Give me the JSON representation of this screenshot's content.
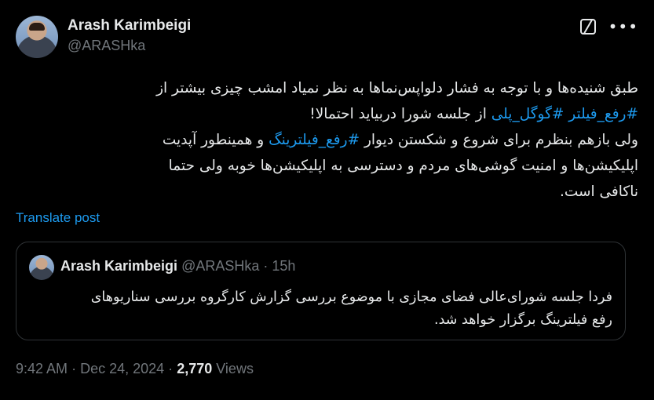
{
  "author": {
    "name": "Arash Karimbeigi",
    "handle": "@ARASHka"
  },
  "post": {
    "line1": "طبق شنیده‌ها و با توجه به فشار دلواپس‌نماها به نظر نمیاد امشب چیزی بیشتر از",
    "hashtag1": "#رفع_فیلتر",
    "hashtag2": "#گوگل_پلی",
    "line2_rest": "از جلسه شورا دربیاید احتمالا!",
    "line3_start": "ولی بازهم بنظرم برای شروع و شکستن دیوار",
    "hashtag3": "#رفع_فیلترینگ",
    "line3_end": "و همینطور آپدیت",
    "line4": "اپلیکیشن‌ها و امنیت گوشی‌های مردم و دسترسی به اپلیکیشن‌ها خوبه ولی حتما",
    "line5": "ناکافی است."
  },
  "translate_label": "Translate post",
  "quote": {
    "name": "Arash Karimbeigi",
    "handle": "@ARASHka",
    "dot": "·",
    "time": "15h",
    "line1": "فردا جلسه شورای‌عالی فضای مجازی با موضوع بررسی گزارش کارگروه بررسی سناریوهای",
    "line2": "رفع فیلترینگ برگزار خواهد شد."
  },
  "meta": {
    "time": "9:42 AM",
    "sep1": "·",
    "date": "Dec 24, 2024",
    "sep2": "·",
    "views_count": "2,770",
    "views_label": "Views"
  },
  "icons": {
    "grok": "grok-icon",
    "more": "more-icon"
  },
  "colors": {
    "background": "#000000",
    "text": "#e7e9ea",
    "secondary": "#71767b",
    "link": "#1d9bf0",
    "border": "#2f3336"
  }
}
